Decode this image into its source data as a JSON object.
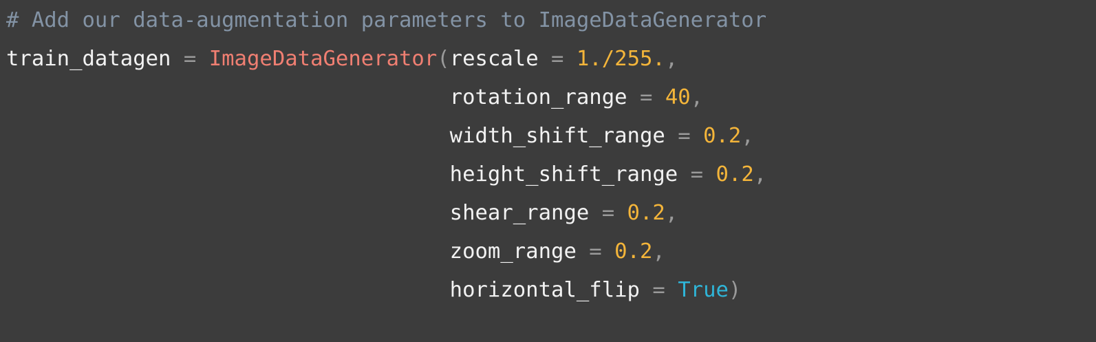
{
  "code": {
    "comment": "# Add our data-augmentation parameters to ImageDataGenerator",
    "var_name": "train_datagen",
    "assign": "=",
    "func_name": "ImageDataGenerator",
    "open_paren": "(",
    "close_paren": ")",
    "comma": ",",
    "equals": "=",
    "args": [
      {
        "name": "rescale",
        "value": "1./255."
      },
      {
        "name": "rotation_range",
        "value": "40"
      },
      {
        "name": "width_shift_range",
        "value": "0.2"
      },
      {
        "name": "height_shift_range",
        "value": "0.2"
      },
      {
        "name": "shear_range",
        "value": "0.2"
      },
      {
        "name": "zoom_range",
        "value": "0.2"
      },
      {
        "name": "horizontal_flip",
        "value": "True"
      }
    ]
  },
  "colors": {
    "background": "#3c3c3c",
    "comment": "#8393a5",
    "identifier": "#f2f2f2",
    "operator": "#9a9a9a",
    "function": "#f07f72",
    "number": "#f4b53a",
    "boolean": "#2fb5d8"
  }
}
